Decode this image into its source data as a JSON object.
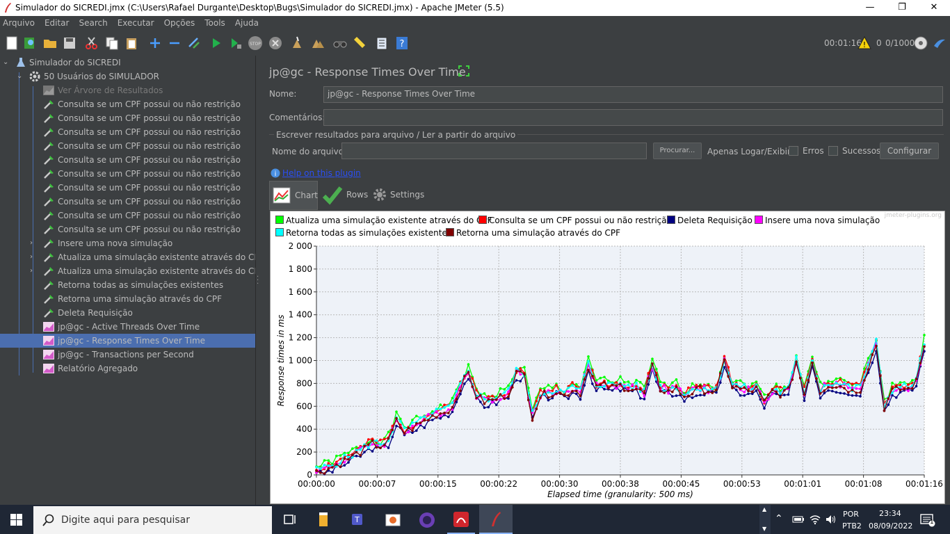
{
  "window": {
    "title": "Simulador do SICREDI.jmx (C:\\Users\\Rafael Durgante\\Desktop\\Bugs\\Simulador do SICREDI.jmx) - Apache JMeter (5.5)",
    "minimize": "—",
    "maximize": "❐",
    "close": "✕"
  },
  "menu": [
    "Arquivo",
    "Editar",
    "Search",
    "Executar",
    "Opções",
    "Tools",
    "Ajuda"
  ],
  "toolbar_status": {
    "elapsed": "00:01:16",
    "warnings": "0",
    "threads": "0/1000"
  },
  "tree": {
    "root": "Simulador do SICREDI",
    "thread_group": "50 Usuários do SIMULADOR",
    "items": [
      {
        "label": "Ver Árvore de Resultados",
        "disabled": true,
        "icon": "graph-icon",
        "expandable": false
      },
      {
        "label": "Consulta se um CPF possui ou não restrição",
        "icon": "pipette-icon",
        "expandable": false
      },
      {
        "label": "Consulta se um CPF possui ou não restrição",
        "icon": "pipette-icon",
        "expandable": false
      },
      {
        "label": "Consulta se um CPF possui ou não restrição",
        "icon": "pipette-icon",
        "expandable": false
      },
      {
        "label": "Consulta se um CPF possui ou não restrição",
        "icon": "pipette-icon",
        "expandable": false
      },
      {
        "label": "Consulta se um CPF possui ou não restrição",
        "icon": "pipette-icon",
        "expandable": false
      },
      {
        "label": "Consulta se um CPF possui ou não restrição",
        "icon": "pipette-icon",
        "expandable": false
      },
      {
        "label": "Consulta se um CPF possui ou não restrição",
        "icon": "pipette-icon",
        "expandable": false
      },
      {
        "label": "Consulta se um CPF possui ou não restrição",
        "icon": "pipette-icon",
        "expandable": false
      },
      {
        "label": "Consulta se um CPF possui ou não restrição",
        "icon": "pipette-icon",
        "expandable": false
      },
      {
        "label": "Consulta se um CPF possui ou não restrição",
        "icon": "pipette-icon",
        "expandable": false
      },
      {
        "label": "Insere uma nova simulação",
        "icon": "pipette-icon",
        "expandable": true
      },
      {
        "label": "Atualiza uma simulação existente através do CPF",
        "icon": "pipette-icon",
        "expandable": true
      },
      {
        "label": "Atualiza uma simulação existente através do CPF",
        "icon": "pipette-icon",
        "expandable": true
      },
      {
        "label": "Retorna todas as simulações existentes",
        "icon": "pipette-icon",
        "expandable": false
      },
      {
        "label": "Retorna uma simulação através do CPF",
        "icon": "pipette-icon",
        "expandable": false
      },
      {
        "label": "Deleta Requisição",
        "icon": "pipette-icon",
        "expandable": false
      },
      {
        "label": "jp@gc - Active Threads Over Time",
        "icon": "graph-icon",
        "expandable": false
      },
      {
        "label": "jp@gc - Response Times Over Time",
        "icon": "graph-icon",
        "expandable": false,
        "selected": true
      },
      {
        "label": "jp@gc - Transactions per Second",
        "icon": "graph-icon",
        "expandable": false
      },
      {
        "label": "Relatório Agregado",
        "icon": "graph-icon",
        "expandable": false
      }
    ]
  },
  "panel": {
    "title": "jp@gc - Response Times Over Time",
    "name_label": "Nome:",
    "name_value": "jp@gc - Response Times Over Time",
    "comments_label": "Comentários:",
    "comments_value": "",
    "file_section": "Escrever resultados para arquivo / Ler a partir do arquivo",
    "file_label": "Nome do arquivo",
    "file_value": "",
    "browse": "Procurar...",
    "log_only": "Apenas Logar/Exibir",
    "errors": "Erros",
    "successes": "Sucessos",
    "configure": "Configurar",
    "help_link": "Help on this plugin",
    "tabs": {
      "chart": "Chart",
      "rows": "Rows",
      "settings": "Settings"
    }
  },
  "chart_data": {
    "type": "line",
    "watermark": "jmeter-plugins.org",
    "xlabel": "Elapsed time (granularity: 500 ms)",
    "ylabel": "Response times in ms",
    "ylim": [
      0,
      2000
    ],
    "xlim_seconds": [
      0,
      76
    ],
    "y_ticks": [
      "0",
      "200",
      "400",
      "600",
      "800",
      "1 000",
      "1 200",
      "1 400",
      "1 600",
      "1 800",
      "2 000"
    ],
    "x_ticks": [
      "00:00:00",
      "00:00:07",
      "00:00:15",
      "00:00:22",
      "00:00:30",
      "00:00:38",
      "00:00:45",
      "00:00:53",
      "00:01:01",
      "00:01:08",
      "00:01:16"
    ],
    "grid": true,
    "legend_position": "top",
    "series": [
      {
        "name": "Atualiza uma simulação existente através do CPF",
        "color": "#00ff00",
        "offset": 40,
        "seed": 1
      },
      {
        "name": "Consulta se um CPF possui ou não restrição",
        "color": "#ff0000",
        "offset": 20,
        "seed": 2
      },
      {
        "name": "Deleta Requisição",
        "color": "#000080",
        "offset": -40,
        "seed": 3
      },
      {
        "name": "Insere uma nova simulação",
        "color": "#ff00ff",
        "offset": 0,
        "seed": 4
      },
      {
        "name": "Retorna todas as simulações existentes",
        "color": "#00ffff",
        "offset": 10,
        "seed": 5
      },
      {
        "name": "Retorna uma simulação através do CPF",
        "color": "#800000",
        "offset": -10,
        "seed": 6
      }
    ],
    "base_profile": [
      [
        0,
        30
      ],
      [
        2,
        80
      ],
      [
        4,
        150
      ],
      [
        6,
        230
      ],
      [
        7,
        280
      ],
      [
        8,
        260
      ],
      [
        9,
        300
      ],
      [
        10,
        480
      ],
      [
        11,
        380
      ],
      [
        12,
        420
      ],
      [
        13,
        460
      ],
      [
        14,
        500
      ],
      [
        15,
        540
      ],
      [
        16,
        560
      ],
      [
        17,
        600
      ],
      [
        18,
        780
      ],
      [
        19,
        900
      ],
      [
        20,
        700
      ],
      [
        21,
        650
      ],
      [
        22,
        660
      ],
      [
        23,
        690
      ],
      [
        24,
        720
      ],
      [
        25,
        900
      ],
      [
        26,
        880
      ],
      [
        27,
        520
      ],
      [
        28,
        700
      ],
      [
        29,
        720
      ],
      [
        30,
        740
      ],
      [
        31,
        700
      ],
      [
        32,
        760
      ],
      [
        33,
        730
      ],
      [
        34,
        960
      ],
      [
        35,
        780
      ],
      [
        36,
        790
      ],
      [
        37,
        770
      ],
      [
        38,
        790
      ],
      [
        39,
        770
      ],
      [
        40,
        760
      ],
      [
        41,
        720
      ],
      [
        42,
        950
      ],
      [
        43,
        760
      ],
      [
        44,
        740
      ],
      [
        45,
        760
      ],
      [
        46,
        700
      ],
      [
        47,
        730
      ],
      [
        48,
        760
      ],
      [
        49,
        750
      ],
      [
        50,
        730
      ],
      [
        51,
        1000
      ],
      [
        52,
        780
      ],
      [
        53,
        760
      ],
      [
        54,
        740
      ],
      [
        55,
        760
      ],
      [
        56,
        640
      ],
      [
        57,
        740
      ],
      [
        58,
        720
      ],
      [
        59,
        740
      ],
      [
        60,
        1000
      ],
      [
        61,
        720
      ],
      [
        62,
        1000
      ],
      [
        63,
        740
      ],
      [
        64,
        800
      ],
      [
        65,
        790
      ],
      [
        66,
        780
      ],
      [
        67,
        740
      ],
      [
        68,
        760
      ],
      [
        69,
        960
      ],
      [
        70,
        1150
      ],
      [
        71,
        600
      ],
      [
        72,
        740
      ],
      [
        73,
        760
      ],
      [
        74,
        760
      ],
      [
        75,
        820
      ],
      [
        76,
        1150
      ]
    ]
  },
  "taskbar": {
    "search_placeholder": "Digite aqui para pesquisar",
    "lang1": "POR",
    "lang2": "PTB2",
    "time": "23:34",
    "date": "08/09/2022",
    "notifications": "1"
  }
}
